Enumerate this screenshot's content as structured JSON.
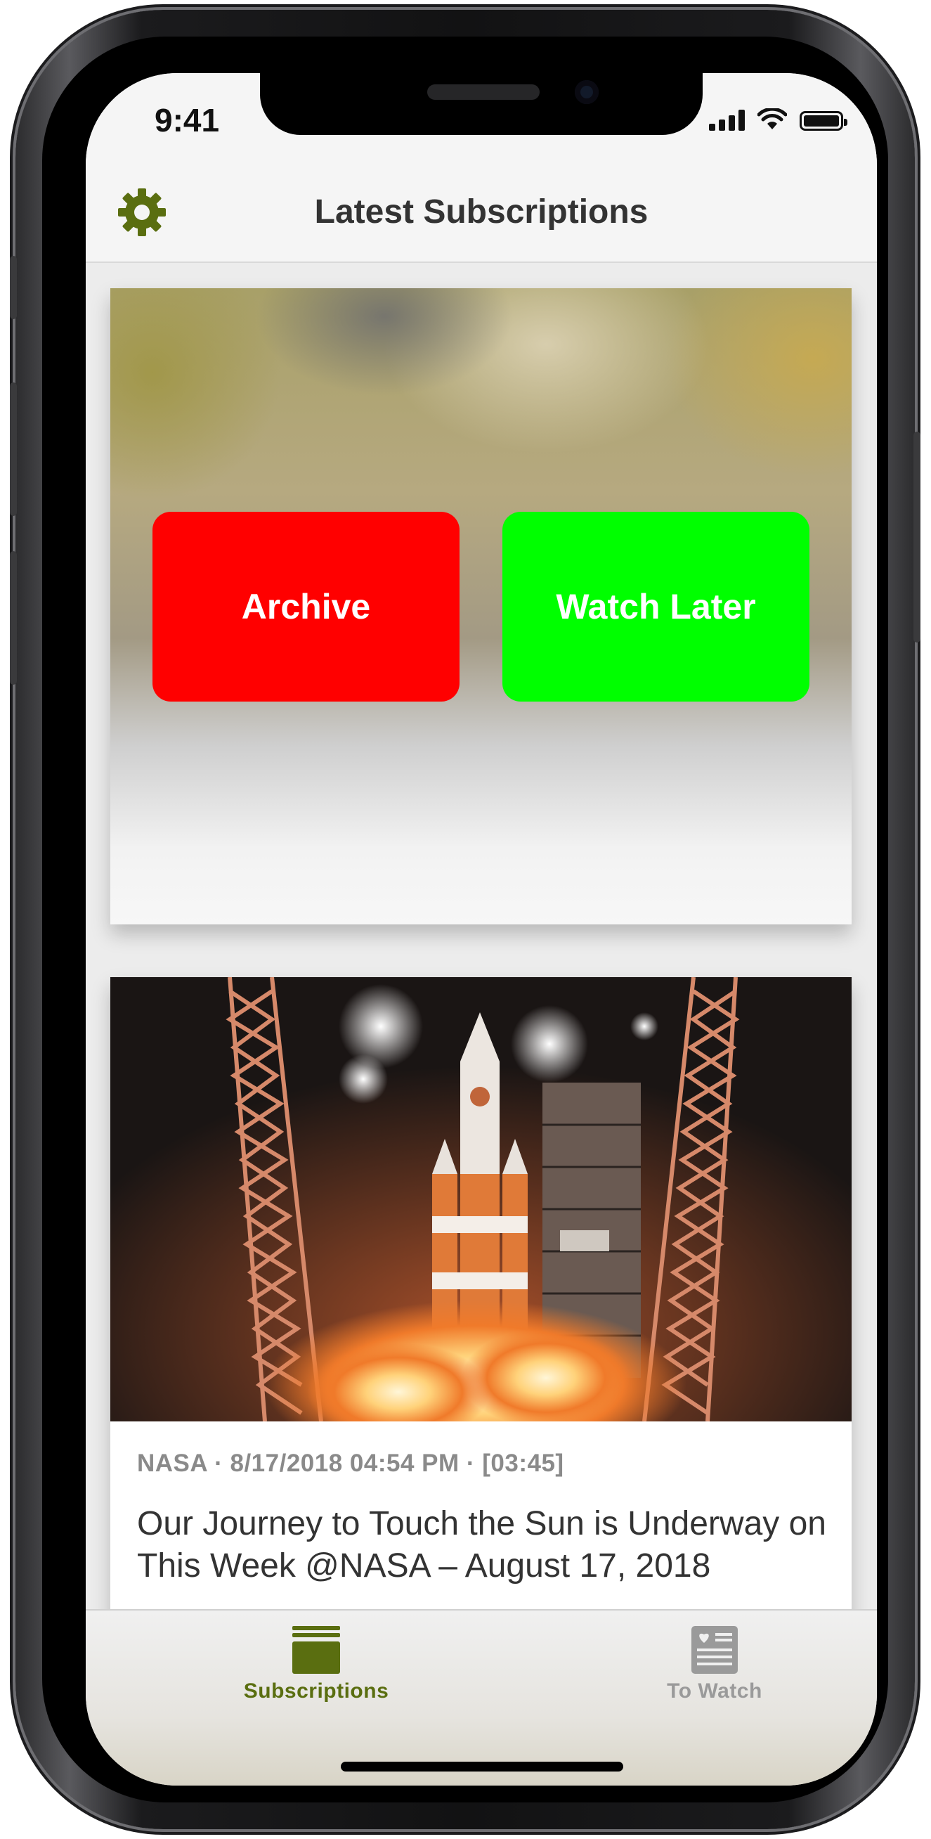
{
  "status_bar": {
    "time": "9:41"
  },
  "nav": {
    "title": "Latest Subscriptions",
    "settings_icon": "gear-icon"
  },
  "cards": [
    {
      "actions": {
        "archive": "Archive",
        "watch_later": "Watch Later"
      }
    },
    {
      "meta": "NASA · 8/17/2018 04:54 PM · [03:45]",
      "title": "Our Journey to Touch the Sun is Underway on This Week @NASA – August 17, 2018"
    }
  ],
  "tabs": [
    {
      "label": "Subscriptions",
      "icon": "stack-icon",
      "active": true
    },
    {
      "label": "To Watch",
      "icon": "list-icon",
      "active": false
    }
  ],
  "colors": {
    "accent": "#5a6e10",
    "archive": "#ff0000",
    "watch_later": "#00ff00",
    "inactive_tab": "#9a9a9a"
  }
}
